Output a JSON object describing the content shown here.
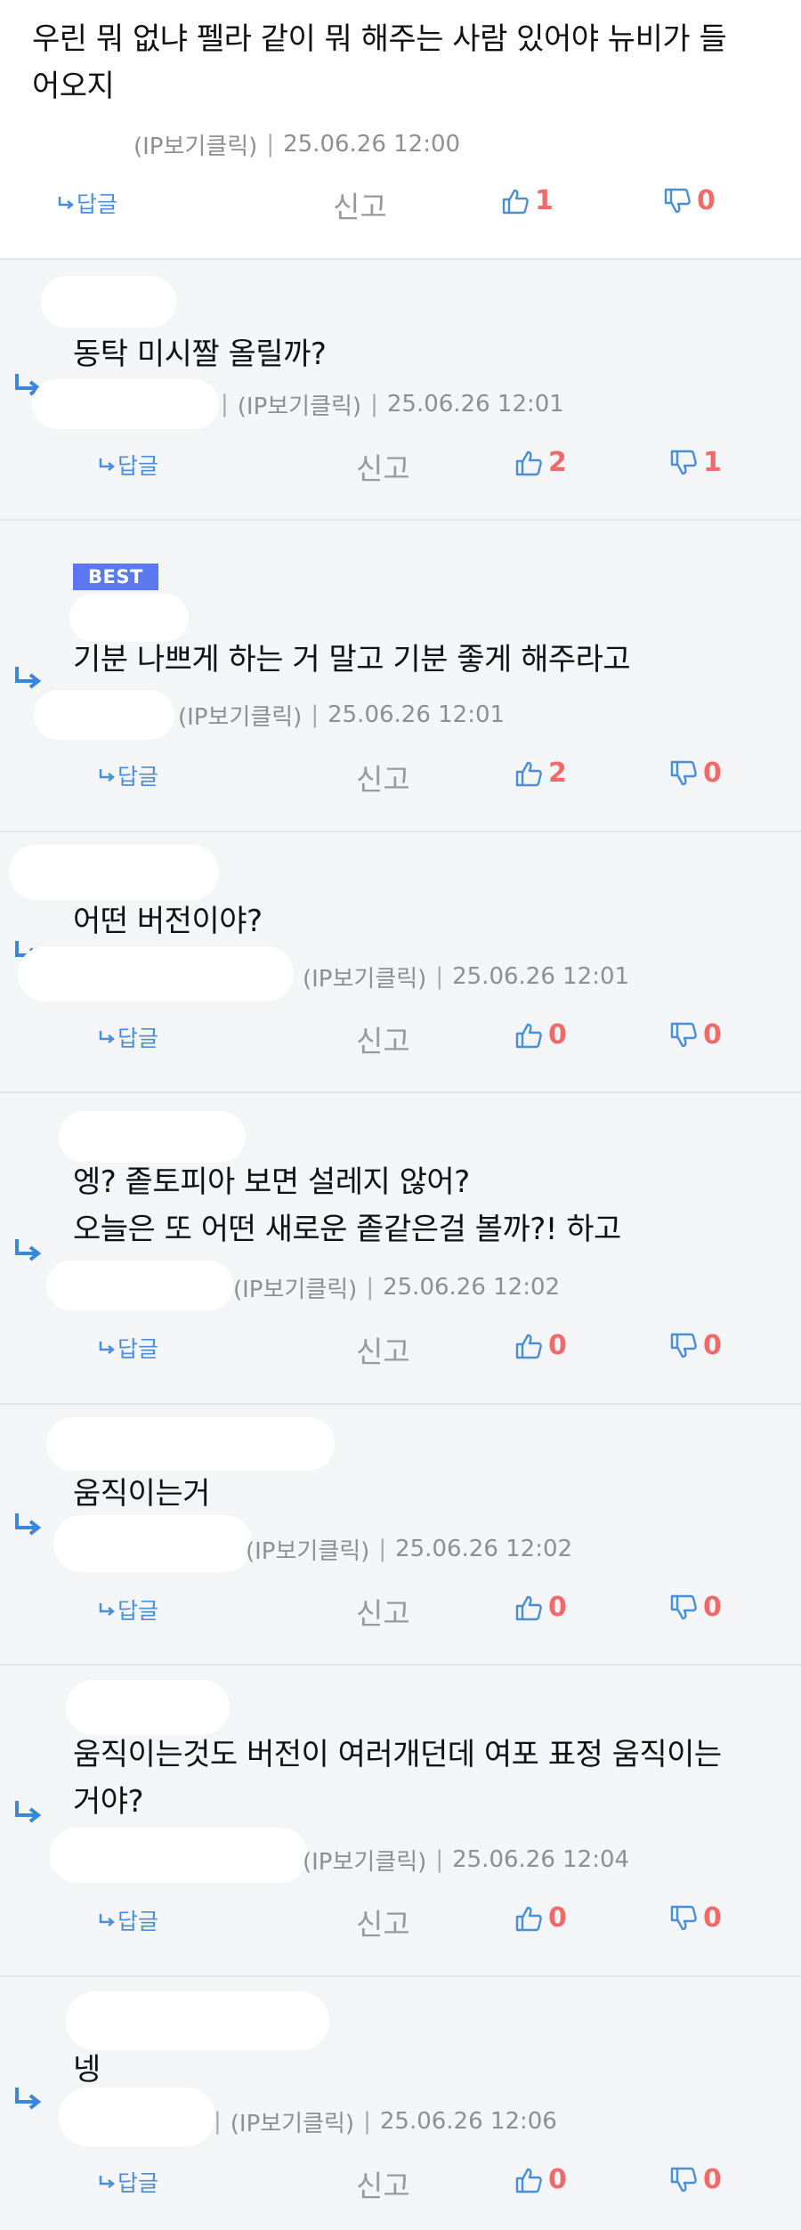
{
  "comments": [
    {
      "type": "top",
      "text_lines": [
        "우린 뭐 없냐 펠라 같이 뭐 해주는 사람 있어야 뉴비가 들",
        "어오지"
      ],
      "ip_label": "(IP보기클릭)",
      "timestamp": "25.06.26 12:00",
      "reply_label": "답글",
      "report_label": "신고",
      "likes": "1",
      "dislikes": "0"
    },
    {
      "type": "reply",
      "text_lines": [
        "동탁 미시짤 올릴까?"
      ],
      "ip_label": "(IP보기클릭)",
      "timestamp": "25.06.26 12:01",
      "reply_label": "답글",
      "report_label": "신고",
      "likes": "2",
      "dislikes": "1"
    },
    {
      "type": "reply",
      "badge": "BEST",
      "text_lines": [
        "기분 나쁘게 하는 거 말고 기분 좋게 해주라고"
      ],
      "ip_label": "(IP보기클릭)",
      "timestamp": "25.06.26 12:01",
      "reply_label": "답글",
      "report_label": "신고",
      "likes": "2",
      "dislikes": "0"
    },
    {
      "type": "reply",
      "text_lines": [
        "어떤 버전이야?"
      ],
      "ip_label": "(IP보기클릭)",
      "timestamp": "25.06.26 12:01",
      "reply_label": "답글",
      "report_label": "신고",
      "likes": "0",
      "dislikes": "0"
    },
    {
      "type": "reply",
      "text_lines": [
        "엥? 좉토피아 보면 설레지 않어?",
        "오늘은 또 어떤 새로운 좉같은걸 볼까?! 하고"
      ],
      "ip_label": "(IP보기클릭)",
      "timestamp": "25.06.26 12:02",
      "reply_label": "답글",
      "report_label": "신고",
      "likes": "0",
      "dislikes": "0"
    },
    {
      "type": "reply",
      "text_lines": [
        "움직이는거"
      ],
      "ip_label": "(IP보기클릭)",
      "timestamp": "25.06.26 12:02",
      "reply_label": "답글",
      "report_label": "신고",
      "likes": "0",
      "dislikes": "0"
    },
    {
      "type": "reply",
      "text_lines": [
        "움직이는것도 버전이 여러개던데 여포 표정 움직이는",
        "거야?"
      ],
      "ip_label": "(IP보기클릭)",
      "timestamp": "25.06.26 12:04",
      "reply_label": "답글",
      "report_label": "신고",
      "likes": "0",
      "dislikes": "0"
    },
    {
      "type": "reply",
      "text_lines": [
        "넹"
      ],
      "ip_label": "(IP보기클릭)",
      "timestamp": "25.06.26 12:06",
      "reply_label": "답글",
      "report_label": "신고",
      "likes": "0",
      "dislikes": "0"
    }
  ],
  "colors": {
    "reply_link": "#4a8fd6",
    "count": "#f06a6a",
    "best_badge": "#5b78f0",
    "reply_background": "#f3f5f7"
  },
  "icons": {
    "reply_action": "reply-arrow-icon",
    "like": "thumbs-up-icon",
    "dislike": "thumbs-down-icon",
    "reply_indicator": "reply-indicator-arrow-icon"
  }
}
